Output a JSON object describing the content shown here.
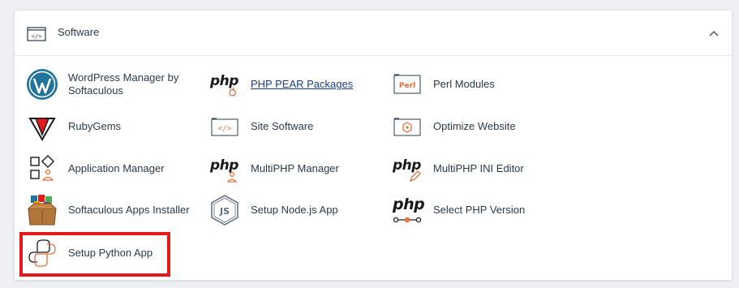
{
  "section": {
    "title": "Software",
    "icon": "code-window-icon",
    "collapse_icon": "chevron-up-icon"
  },
  "items": [
    {
      "label": "WordPress Manager by Softaculous",
      "icon": "wordpress-icon"
    },
    {
      "label": "PHP PEAR Packages",
      "icon": "php-pear-icon"
    },
    {
      "label": "Perl Modules",
      "icon": "perl-icon"
    },
    {
      "label": "RubyGems",
      "icon": "ruby-gem-icon"
    },
    {
      "label": "Site Software",
      "icon": "code-window-icon"
    },
    {
      "label": "Optimize Website",
      "icon": "optimize-icon"
    },
    {
      "label": "Application Manager",
      "icon": "app-grid-icon"
    },
    {
      "label": "MultiPHP Manager",
      "icon": "php-user-icon"
    },
    {
      "label": "MultiPHP INI Editor",
      "icon": "php-edit-icon"
    },
    {
      "label": "Softaculous Apps Installer",
      "icon": "softaculous-box-icon"
    },
    {
      "label": "Setup Node.js App",
      "icon": "nodejs-icon"
    },
    {
      "label": "Select PHP Version",
      "icon": "php-version-icon"
    },
    {
      "label": "Setup Python App",
      "icon": "python-icon"
    }
  ],
  "icon_text": {
    "php": "php",
    "perl": "Perl",
    "code": "</>",
    "js": "JS"
  },
  "colors": {
    "accent": "#e8703a",
    "link": "#1b3d86",
    "highlight": "#e5191c",
    "wordpress": "#21759b"
  }
}
